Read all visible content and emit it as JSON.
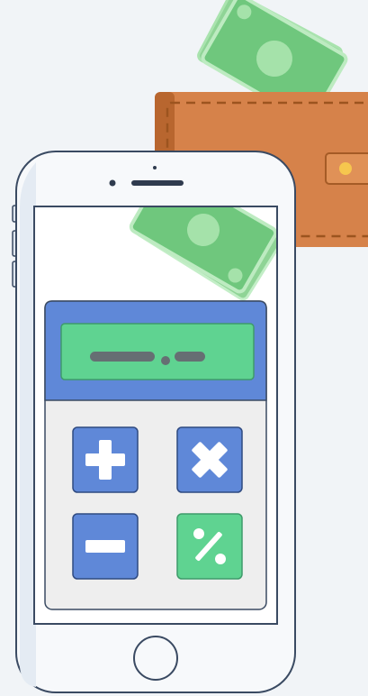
{
  "scene": {
    "description_icons": [
      "wallet-icon",
      "banknotes-icon",
      "smartphone-icon",
      "calculator-icon",
      "plus-icon",
      "multiply-icon",
      "minus-icon",
      "percent-icon"
    ]
  },
  "calculator": {
    "display_text": "",
    "keys": [
      {
        "icon": "plus-icon",
        "color": "#5f88d8"
      },
      {
        "icon": "multiply-icon",
        "color": "#5f88d8"
      },
      {
        "icon": "minus-icon",
        "color": "#5f88d8"
      },
      {
        "icon": "percent-icon",
        "color": "#5fd391"
      }
    ]
  },
  "colors": {
    "background": "#f1f4f7",
    "wallet": "#d6824a",
    "wallet_dark": "#b5622c",
    "cash": "#6cc47a",
    "cash_light": "#9ee0a6",
    "phone_outline": "#3a4a62",
    "calculator_header": "#5f88d8",
    "display": "#5fd391",
    "accent_percent": "#5fd391"
  }
}
